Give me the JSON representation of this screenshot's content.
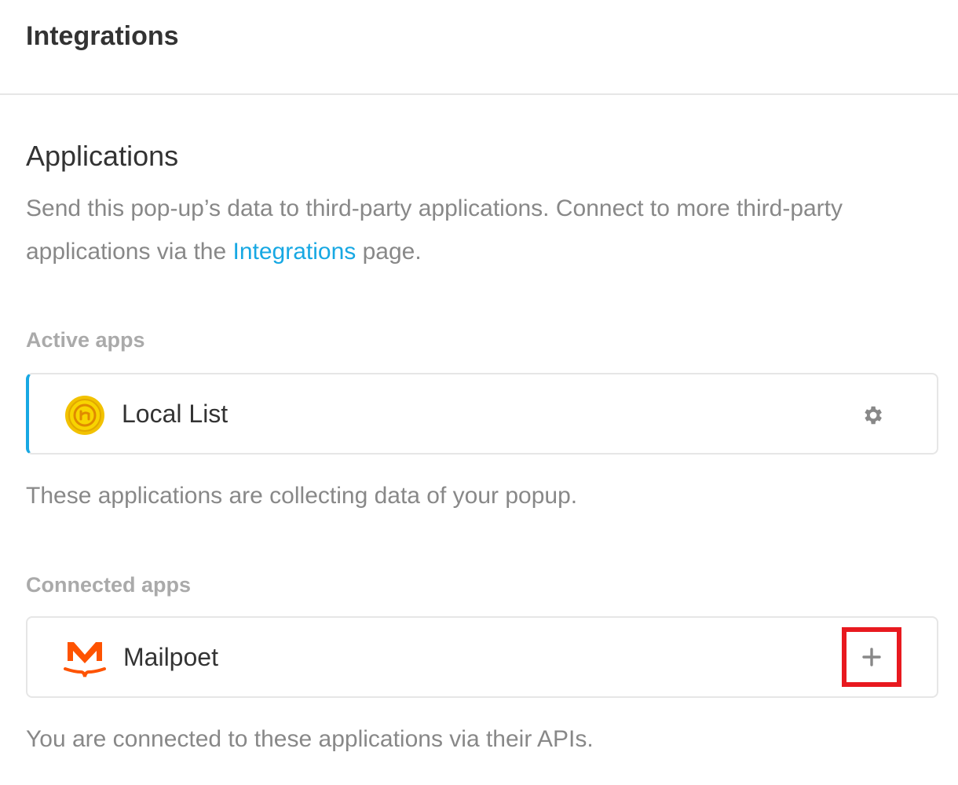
{
  "header": {
    "title": "Integrations"
  },
  "applications": {
    "title": "Applications",
    "description_before": "Send this pop-up’s data to third-party applications. Connect to more third-party applications via the ",
    "description_link": "Integrations",
    "description_after": " page."
  },
  "active_apps": {
    "label": "Active apps",
    "items": [
      {
        "name": "Local List",
        "logo_icon": "local-list-logo-icon",
        "action_icon": "gear-icon"
      }
    ],
    "helper": "These applications are collecting data of your popup."
  },
  "connected_apps": {
    "label": "Connected apps",
    "items": [
      {
        "name": "Mailpoet",
        "logo_icon": "mailpoet-logo-icon",
        "action_icon": "plus-icon"
      }
    ],
    "helper": "You are connected to these applications via their APIs."
  },
  "colors": {
    "accent": "#17a8e3",
    "highlight": "#e8191f",
    "local_list_logo": "#f2c200",
    "mailpoet_logo": "#fe5301"
  }
}
